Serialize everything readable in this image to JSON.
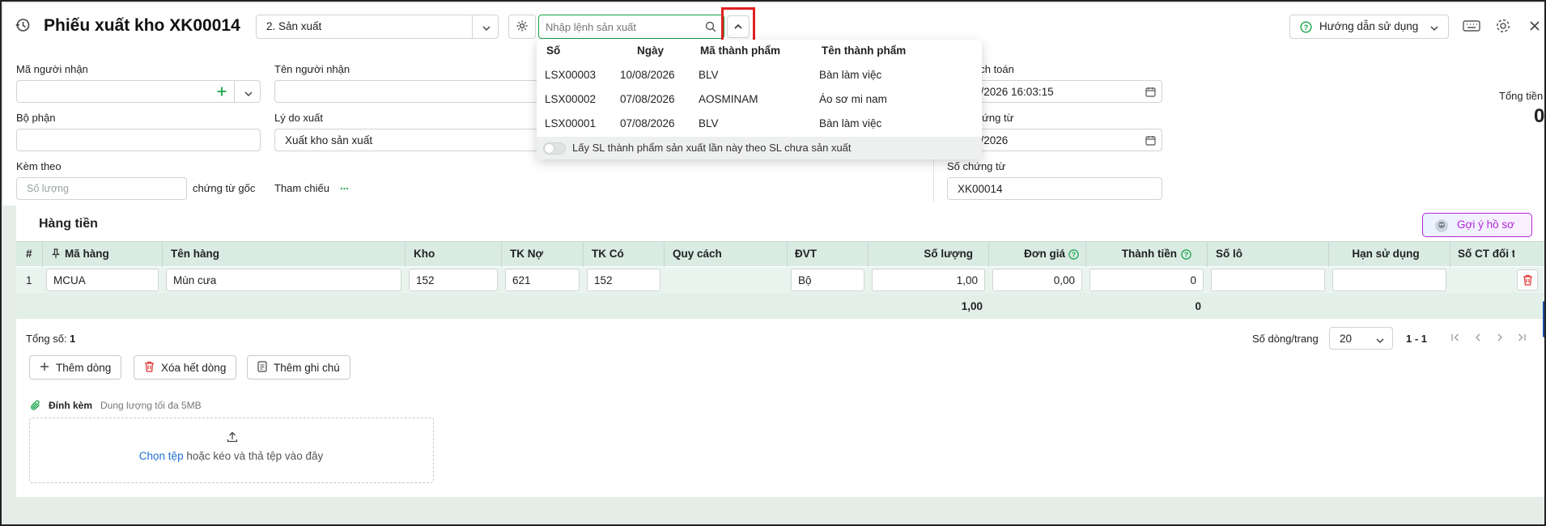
{
  "header": {
    "title": "Phiếu xuất kho XK00014",
    "type_select": "2. Sản xuất",
    "search_placeholder": "Nhập lệnh sản xuất",
    "help_label": "Hướng dẫn sử dụng"
  },
  "form": {
    "receiver_code_label": "Mã người nhận",
    "receiver_name_label": "Tên người nhận",
    "department_label": "Bộ phận",
    "reason_label": "Lý do xuất",
    "reason_value": "Xuất kho sản xuất",
    "attach_label": "Kèm theo",
    "quantity_placeholder": "Số lượng",
    "original_docs": "chứng từ gốc",
    "reference_label": "Tham chiếu",
    "reference_more": "...",
    "posting_date_label": "ạch toán",
    "posting_date_value": "8/2026 16:03:15",
    "doc_date_label": "hứng từ",
    "doc_date_value": "8/2026",
    "doc_no_label": "Số chứng từ",
    "doc_no_value": "XK00014",
    "total_label": "Tổng tiền",
    "total_value": "0"
  },
  "dropdown": {
    "headers": [
      "Số",
      "Ngày",
      "Mã thành phẩm",
      "Tên thành phẩm"
    ],
    "rows": [
      {
        "so": "LSX00003",
        "ngay": "10/08/2026",
        "ma": "BLV",
        "ten": "Bàn làm việc"
      },
      {
        "so": "LSX00002",
        "ngay": "07/08/2026",
        "ma": "AOSMINAM",
        "ten": "Áo sơ mi nam"
      },
      {
        "so": "LSX00001",
        "ngay": "07/08/2026",
        "ma": "BLV",
        "ten": "Bàn làm việc"
      }
    ],
    "toggle_label": "Lấy SL thành phẩm sản xuất lần này theo SL chưa sản xuất",
    "toggle_on": false
  },
  "section": {
    "title": "Hàng tiền",
    "suggest_label": "Gợi ý hồ sơ"
  },
  "table": {
    "columns": [
      "#",
      "Mã hàng",
      "Tên hàng",
      "Kho",
      "TK Nợ",
      "TK Có",
      "Quy cách",
      "ĐVT",
      "Số lượng",
      "Đơn giá",
      "Thành tiền",
      "Số lô",
      "Hạn sử dụng",
      "Số CT đối t"
    ],
    "rows": [
      {
        "no": "1",
        "ma_hang": "MCUA",
        "ten_hang": "Mùn cưa",
        "kho": "152",
        "tk_no": "621",
        "tk_co": "152",
        "quy_cach": "",
        "dvt": "Bộ",
        "so_luong": "1,00",
        "don_gia": "0,00",
        "thanh_tien": "0",
        "so_lo": "",
        "han_su_dung": ""
      }
    ],
    "footer": {
      "so_luong": "1,00",
      "thanh_tien": "0"
    }
  },
  "pagination": {
    "total_label": "Tổng số:",
    "total_value": "1",
    "rows_per_page_label": "Số dòng/trang",
    "rows_per_page": "20",
    "range": "1 - 1"
  },
  "actions": {
    "add_row": "Thêm dòng",
    "delete_all": "Xóa hết dòng",
    "add_note": "Thêm ghi chú"
  },
  "attachment": {
    "label": "Đính kèm",
    "limit": "Dung lượng tối đa 5MB",
    "choose": "Chọn tệp",
    "drop_text": "hoặc kéo và thả tệp vào đây"
  },
  "colors": {
    "accent": "#17a34a",
    "highlight_box": "#e02020",
    "header_row": "#d9ebe3",
    "delete_red": "#e03030",
    "link_blue": "#1f6fd1",
    "purple": "#b026d6"
  }
}
